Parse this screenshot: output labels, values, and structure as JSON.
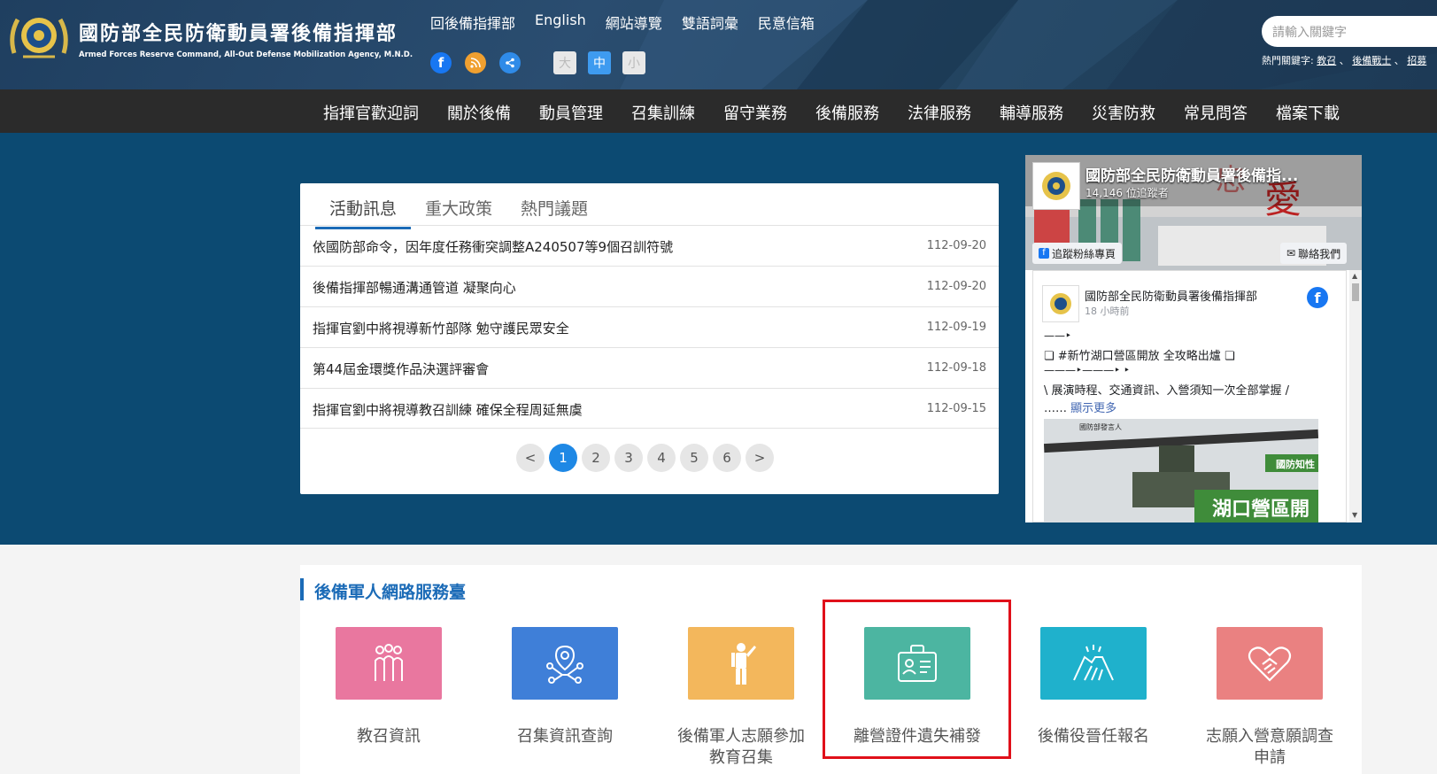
{
  "header": {
    "title": "國防部全民防衛動員署後備指揮部",
    "subtitle": "Armed Forces Reserve Command, All-Out Defense Mobilization Agency, M.N.D.",
    "top_links": [
      "回後備指揮部",
      "English",
      "網站導覽",
      "雙語詞彙",
      "民意信箱"
    ],
    "font_sizes": [
      "大",
      "中",
      "小"
    ],
    "search_placeholder": "請輸入關鍵字",
    "hot_keywords_label": "熱門關鍵字:",
    "hot_keywords": [
      "教召",
      "後備戰士",
      "招募"
    ]
  },
  "nav": {
    "items": [
      "指揮官歡迎詞",
      "關於後備",
      "動員管理",
      "召集訓練",
      "留守業務",
      "後備服務",
      "法律服務",
      "輔導服務",
      "災害防救",
      "常見問答",
      "檔案下載"
    ]
  },
  "news": {
    "tabs": [
      "活動訊息",
      "重大政策",
      "熱門議題"
    ],
    "rows": [
      {
        "title": "依國防部命令，因年度任務衝突調整A240507等9個召訓符號",
        "date": "112-09-20"
      },
      {
        "title": "後備指揮部暢通溝通管道 凝聚向心",
        "date": "112-09-20"
      },
      {
        "title": "指揮官劉中將視導新竹部隊 勉守護民眾安全",
        "date": "112-09-19"
      },
      {
        "title": "第44屆金環獎作品決選評審會",
        "date": "112-09-18"
      },
      {
        "title": "指揮官劉中將視導教召訓練 確保全程周延無虞",
        "date": "112-09-15"
      }
    ],
    "pager": {
      "prev": "<",
      "pages": [
        "1",
        "2",
        "3",
        "4",
        "5",
        "6"
      ],
      "next": ">",
      "current": "1"
    }
  },
  "facebook": {
    "page_name": "國防部全民防衛動員署後備指...",
    "followers": "14,146 位追蹤者",
    "follow_btn": "追蹤粉絲專頁",
    "contact_btn": "聯絡我們",
    "post_author": "國防部全民防衛動員署後備指揮部",
    "post_time": "18 小時前",
    "post_lines": [
      "——‣",
      "❏ #新竹湖口營區開放 全攻略出爐 ❏",
      "———‣———‣ ‣",
      "\\ 展演時程、交通資訊、入營須知一次全部掌握 /"
    ],
    "post_more_prefix": "……",
    "post_more": "顯示更多",
    "image_tag": "國防部發言人",
    "image_label1": "國防知性",
    "image_label2": "湖口營區開"
  },
  "services": {
    "title": "後備軍人網路服務臺",
    "items": [
      {
        "label": "教召資訊",
        "color": "#e9779f",
        "icon": "people-group-icon"
      },
      {
        "label": "召集資訊查詢",
        "color": "#3f7fd8",
        "icon": "location-network-icon"
      },
      {
        "label": "後備軍人志願參加\n教育召集",
        "color": "#f3b75c",
        "icon": "soldier-salute-icon"
      },
      {
        "label": "離營證件遺失補發",
        "color": "#4cb5a1",
        "icon": "id-badge-icon"
      },
      {
        "label": "後備役晉任報名",
        "color": "#1fb1cc",
        "icon": "handshake-icon"
      },
      {
        "label": "志願入營意願調查\n申請",
        "color": "#ea8181",
        "icon": "heart-hands-icon"
      }
    ]
  }
}
